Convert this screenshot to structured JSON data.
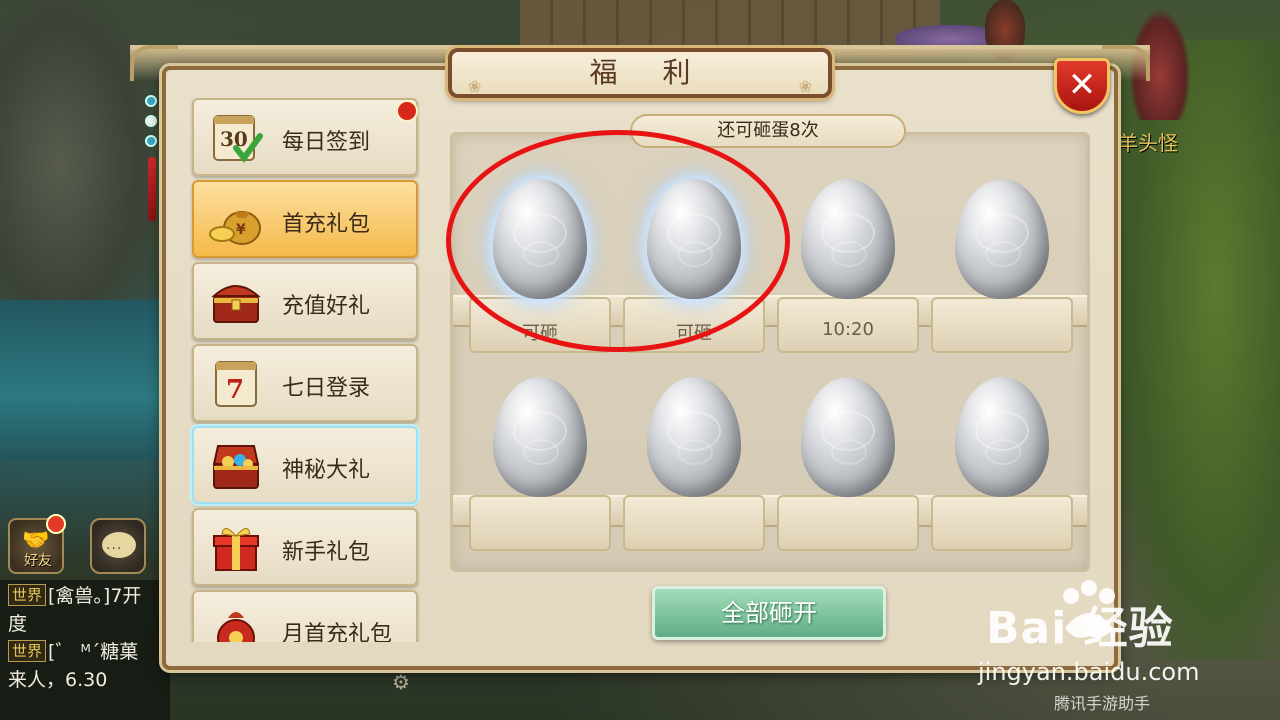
{
  "scene": {
    "npc_name": "羊头怪"
  },
  "window": {
    "title": "福 利",
    "close_label": "✕"
  },
  "sidebar": {
    "items": [
      {
        "label": "每日签到",
        "icon": "daily-calendar-icon",
        "badge": true
      },
      {
        "label": "首充礼包",
        "icon": "money-bag-icon",
        "active": true
      },
      {
        "label": "充值好礼",
        "icon": "treasure-chest-icon"
      },
      {
        "label": "七日登录",
        "icon": "seven-day-calendar-icon"
      },
      {
        "label": "神秘大礼",
        "icon": "open-treasure-chest-icon",
        "hover": true
      },
      {
        "label": "新手礼包",
        "icon": "gift-box-icon"
      },
      {
        "label": "月首充礼包",
        "icon": "red-pouch-icon"
      }
    ]
  },
  "eggs": {
    "counter": "还可砸蛋8次",
    "slots": [
      {
        "status": "可砸",
        "glow": true
      },
      {
        "status": "可砸",
        "glow": true
      },
      {
        "status": "10:20",
        "glow": false
      },
      {
        "status": "",
        "glow": false
      },
      {
        "status": "",
        "glow": false
      },
      {
        "status": "",
        "glow": false
      },
      {
        "status": "",
        "glow": false
      },
      {
        "status": "",
        "glow": false
      }
    ],
    "smash_all_label": "全部砸开"
  },
  "social": {
    "friend_label": "好友",
    "chat_bubble": "..."
  },
  "chat": {
    "lines": [
      {
        "tag": "世界",
        "text": "[禽兽。]7开"
      },
      {
        "tag": "",
        "text": "度"
      },
      {
        "tag": "世界",
        "text": "[゛ ᴹ´糖菓"
      },
      {
        "tag": "",
        "text": "来人，6.30"
      }
    ]
  },
  "watermark": {
    "brand": "Bai 经验",
    "url": "jingyan.baidu.com",
    "sub": "腾讯手游助手"
  },
  "colors": {
    "annotation": "#e81414",
    "smash_button": "#5fae86",
    "close_button": "#d22a1e"
  }
}
